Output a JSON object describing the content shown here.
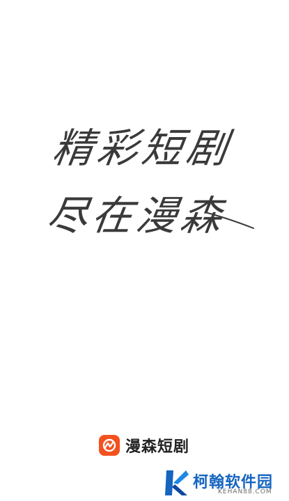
{
  "splash": {
    "slogan_line1": "精彩短剧",
    "slogan_line2": "尽在漫森"
  },
  "brand": {
    "name": "漫森短剧",
    "logo_icon": "manseng-logo-icon",
    "accent_color": "#f4511e"
  },
  "watermark": {
    "title": "柯翰软件园",
    "subtitle": "KEHAN88.COM",
    "logo_icon": "kehan-k-logo-icon",
    "color": "#1565c0"
  }
}
